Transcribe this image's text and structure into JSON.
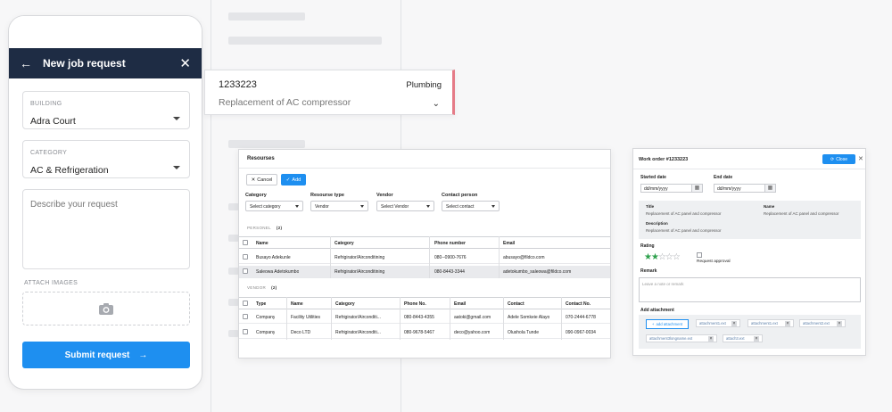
{
  "phone": {
    "title": "New job request",
    "building": {
      "label": "BUILDING",
      "value": "Adra Court"
    },
    "category": {
      "label": "CATEGORY",
      "value": "AC & Refrigeration"
    },
    "describe_placeholder": "Describe your request",
    "attach_label": "ATTACH IMAGES",
    "submit_label": "Submit request"
  },
  "job_card": {
    "number": "1233223",
    "tag": "Plumbing",
    "description": "Replacement of AC compressor"
  },
  "resources": {
    "title": "Resourses",
    "cancel_label": "Cancel",
    "add_label": "Add",
    "filters": [
      {
        "label": "Category",
        "value": "Select category"
      },
      {
        "label": "Resourse type",
        "value": "Vendor"
      },
      {
        "label": "Vendor",
        "value": "Select Vendor"
      },
      {
        "label": "Contact person",
        "value": "Select contact"
      }
    ],
    "personel": {
      "section": "PERSONEL",
      "count": "(2)",
      "columns": [
        "Name",
        "Category",
        "Phone number",
        "Email"
      ],
      "rows": [
        [
          "Busayo Adekunle",
          "Refrigirator/Airconditining",
          "080--0900-7676",
          "abusayo@fildco.com"
        ],
        [
          "Saleowa Adetokumbo",
          "Refrigirator/Airconditining",
          "080-8443-3344",
          "adetokumbo_saleowa@fildco.com"
        ]
      ]
    },
    "vendor": {
      "section": "VENDOR",
      "count": "(2)",
      "columns": [
        "Type",
        "Name",
        "Category",
        "Phone No.",
        "Email",
        "Contact",
        "Contact No."
      ],
      "rows": [
        [
          "Company",
          "Facility Utilities",
          "Refrigirator/Airconditi...",
          "080-8443-4355",
          "aatoki@gmail.com",
          "Adele Somkeie Alayo",
          "070-2444-6778"
        ],
        [
          "Company",
          "Deco LTD",
          "Refrigirator/Airconditi...",
          "080-9678-5467",
          "deco@yahoo.com",
          "Olushola Tunde",
          "090-0967-0034"
        ]
      ]
    }
  },
  "work_order": {
    "title": "Work order #1233223",
    "close_label": "Close",
    "started_label": "Started date",
    "end_label": "End date",
    "date_placeholder": "dd/mm/yyyy",
    "title_key": "Title",
    "title_value": "Replacement of AC panel and compressor",
    "name_key": "Name",
    "name_value": "Replacement of AC panel and compressor",
    "description_key": "Description",
    "description_value": "Replacement of AC panel and compressor",
    "rating_label": "Rating",
    "rating_value": 2,
    "rating_max": 5,
    "request_approval_label": "Request approval",
    "remark_label": "Remark",
    "remark_placeholder": "Leave a note or remark",
    "add_attachment_label": "Add attachment",
    "add_attachment_button": "add attachment",
    "attachments": [
      "attachment1.ext",
      "attachment1.ext",
      "attachment2.ext",
      "attachment3longname.ext",
      "attach3.ext"
    ]
  },
  "colors": {
    "navy": "#1e2c44",
    "primary": "#1e8ff0",
    "accent_red": "#e57b87",
    "star_green": "#2fa14d"
  }
}
